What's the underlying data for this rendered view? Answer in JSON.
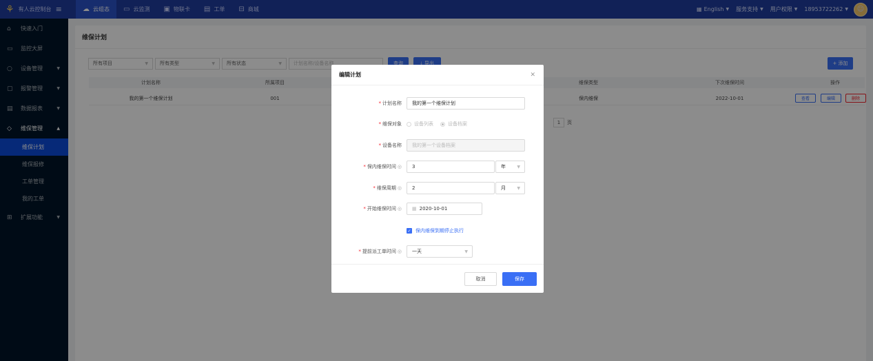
{
  "topbar": {
    "brand": "有人云控制台",
    "tabs": [
      {
        "label": "云组态",
        "icon": "cloud-icon"
      },
      {
        "label": "云监测",
        "icon": "monitor-icon"
      },
      {
        "label": "物联卡",
        "icon": "sim-card-icon"
      },
      {
        "label": "工单",
        "icon": "ticket-icon"
      },
      {
        "label": "商城",
        "icon": "shop-icon"
      }
    ],
    "language": "English",
    "service": "服务支持",
    "user_perm": "用户权限",
    "phone": "18953722262"
  },
  "sidebar": {
    "items": [
      {
        "label": "快速入门",
        "icon": "home-icon"
      },
      {
        "label": "监控大屏",
        "icon": "screen-icon"
      },
      {
        "label": "设备管理",
        "icon": "device-icon"
      },
      {
        "label": "报警管理",
        "icon": "alarm-icon"
      },
      {
        "label": "数据报表",
        "icon": "report-icon"
      },
      {
        "label": "维保管理",
        "icon": "shield-icon"
      }
    ],
    "sub_items": [
      "维保计划",
      "维保报修",
      "工单管理",
      "我的工单"
    ],
    "extra": {
      "label": "扩展功能",
      "icon": "grid-icon"
    }
  },
  "main": {
    "title": "维保计划",
    "filters": {
      "project": "所有项目",
      "type": "所有类型",
      "status": "所有状态",
      "search_placeholder": "计划名称/设备名称",
      "search_btn": "查询",
      "export_btn": "导出",
      "add_btn": "+ 添加"
    },
    "table": {
      "headers": [
        "计划名称",
        "所属项目",
        "维保类型",
        "下次维保时间",
        "操作"
      ],
      "row": {
        "name": "我的第一个维保计划",
        "project": "001",
        "type": "保内维保",
        "next_time": "2022-10-01"
      },
      "ops": [
        "查看",
        "编辑",
        "删除"
      ]
    },
    "pager": {
      "page": "1",
      "suffix": "页"
    }
  },
  "modal": {
    "title": "编辑计划",
    "fields": {
      "plan_name": {
        "label": "计划名称",
        "value": "我的第一个维保计划"
      },
      "target": {
        "label": "维保对象",
        "opt1": "设备列表",
        "opt2": "设备档案"
      },
      "device_name": {
        "label": "设备名称",
        "value": "我的第一个设备档案"
      },
      "warranty_time": {
        "label": "保内维保时间",
        "value": "3",
        "unit": "年"
      },
      "period": {
        "label": "维保周期",
        "value": "2",
        "unit": "月"
      },
      "start_time": {
        "label": "开始维保时间",
        "value": "2020-10-01"
      },
      "stop_check": {
        "label": "保内维保到期停止执行",
        "checked": true
      },
      "advance": {
        "label": "提前派工单时间",
        "value": "一天"
      }
    },
    "cancel": "取消",
    "save": "保存"
  }
}
